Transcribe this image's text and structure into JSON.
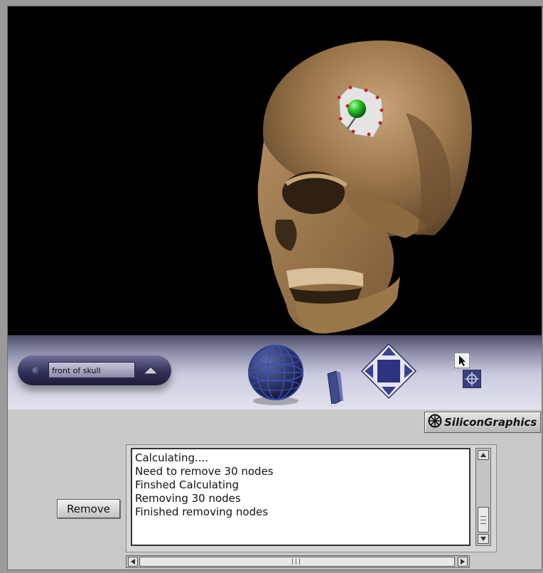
{
  "viewer": {
    "view_selector": {
      "value": "front of skull"
    },
    "colors": {
      "background": "#000000",
      "skull": "#a07c52",
      "selection_handle": "#33cc33",
      "control_points": "#cc2222"
    }
  },
  "toolbar": {
    "rotate_tool": {
      "icon": "sphere-icon"
    },
    "dolly_tool": {
      "icon": "slider-icon"
    },
    "pan_tool": {
      "icon": "diamond-arrows-icon"
    },
    "pick_tool": {
      "icon": "cursor-icon"
    },
    "zoom_tool": {
      "icon": "crosshair-icon"
    }
  },
  "brand": {
    "logo_text": "SiliconGraphics"
  },
  "actions": {
    "remove_label": "Remove"
  },
  "log": {
    "lines": [
      "Calculating....",
      "Need to remove 30 nodes",
      "Finshed Calculating",
      "Removing 30 nodes",
      "Finished removing nodes"
    ]
  }
}
